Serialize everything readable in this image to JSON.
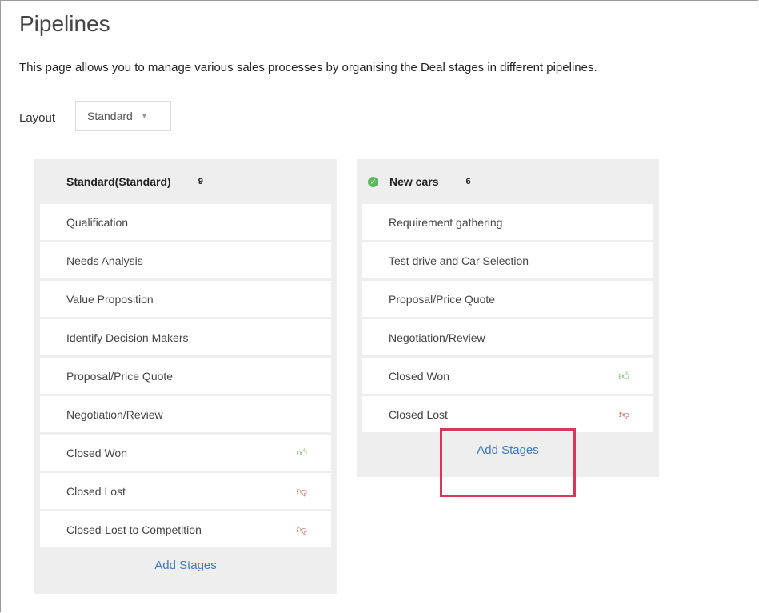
{
  "page": {
    "title": "Pipelines",
    "description": "This page allows you to manage various sales processes by organising the Deal stages in different pipelines."
  },
  "layout": {
    "label": "Layout",
    "selected": "Standard"
  },
  "pipelines": [
    {
      "name": "Standard(Standard)",
      "count": "9",
      "stages": [
        {
          "label": "Qualification",
          "icon": ""
        },
        {
          "label": "Needs Analysis",
          "icon": ""
        },
        {
          "label": "Value Proposition",
          "icon": ""
        },
        {
          "label": "Identify Decision Makers",
          "icon": ""
        },
        {
          "label": "Proposal/Price Quote",
          "icon": ""
        },
        {
          "label": "Negotiation/Review",
          "icon": ""
        },
        {
          "label": "Closed Won",
          "icon": "thumbs-up-icon"
        },
        {
          "label": "Closed Lost",
          "icon": "thumbs-down-icon"
        },
        {
          "label": "Closed-Lost to Competition",
          "icon": "thumbs-down-icon"
        }
      ],
      "add_label": "Add Stages"
    },
    {
      "name": "New cars",
      "count": "6",
      "status_icon": "check-circle-icon",
      "stages": [
        {
          "label": "Requirement gathering",
          "icon": ""
        },
        {
          "label": "Test drive and Car Selection",
          "icon": ""
        },
        {
          "label": "Proposal/Price Quote",
          "icon": ""
        },
        {
          "label": "Negotiation/Review",
          "icon": ""
        },
        {
          "label": "Closed Won",
          "icon": "thumbs-up-icon"
        },
        {
          "label": "Closed Lost",
          "icon": "thumbs-down-icon"
        }
      ],
      "add_label": "Add Stages"
    }
  ],
  "colors": {
    "link": "#3d78c4",
    "won": "#6ab04c",
    "lost": "#c0392b",
    "active_status": "#5cb85c",
    "highlight": "#d9365c"
  }
}
